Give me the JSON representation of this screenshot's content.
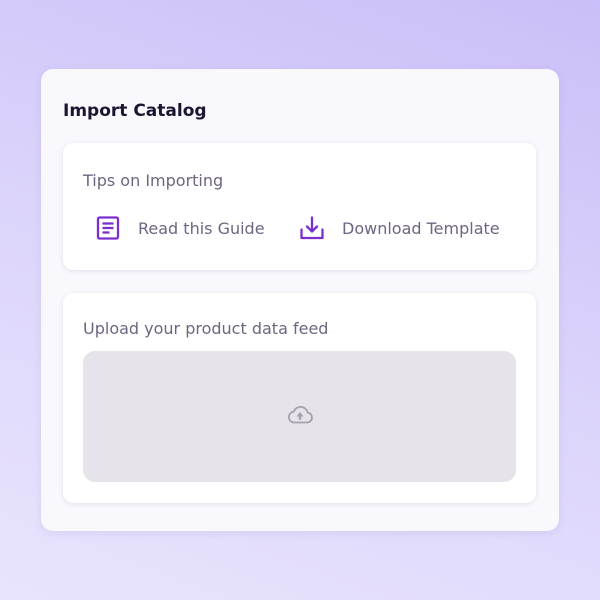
{
  "panel": {
    "title": "Import Catalog"
  },
  "tips": {
    "heading": "Tips on Importing",
    "links": [
      {
        "label": "Read this Guide",
        "icon": "document-icon"
      },
      {
        "label": "Download Template",
        "icon": "download-icon"
      }
    ]
  },
  "upload": {
    "heading": "Upload your product data feed",
    "dropzone_icon": "cloud-upload-icon"
  },
  "colors": {
    "accent": "#7b2fd1",
    "dropzone_bg": "#e6e3ea",
    "muted_text": "#6e6580"
  }
}
